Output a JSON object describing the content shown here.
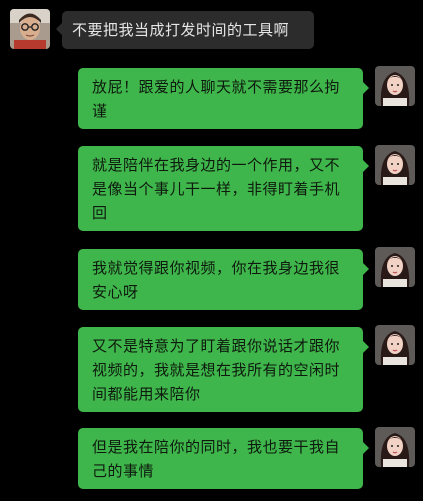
{
  "colors": {
    "background": "#000000",
    "incoming_bubble": "#2c2c2c",
    "outgoing_bubble": "#3fb64b",
    "incoming_text": "#e6e6e6",
    "outgoing_text": "#0e1a0e"
  },
  "messages": [
    {
      "side": "left",
      "avatar": "male-avatar-glasses",
      "text": "不要把我当成打发时间的工具啊"
    },
    {
      "side": "right",
      "avatar": "female-avatar",
      "text": "放屁！跟爱的人聊天就不需要那么拘谨"
    },
    {
      "side": "right",
      "avatar": "female-avatar",
      "text": "就是陪伴在我身边的一个作用，又不是像当个事儿干一样，非得盯着手机回"
    },
    {
      "side": "right",
      "avatar": "female-avatar",
      "text": "我就觉得跟你视频，你在我身边我很安心呀"
    },
    {
      "side": "right",
      "avatar": "female-avatar",
      "text": "又不是特意为了盯着跟你说话才跟你视频的，我就是想在我所有的空闲时间都能用来陪你"
    },
    {
      "side": "right",
      "avatar": "female-avatar",
      "text": "但是我在陪你的同时，我也要干我自己的事情"
    }
  ]
}
